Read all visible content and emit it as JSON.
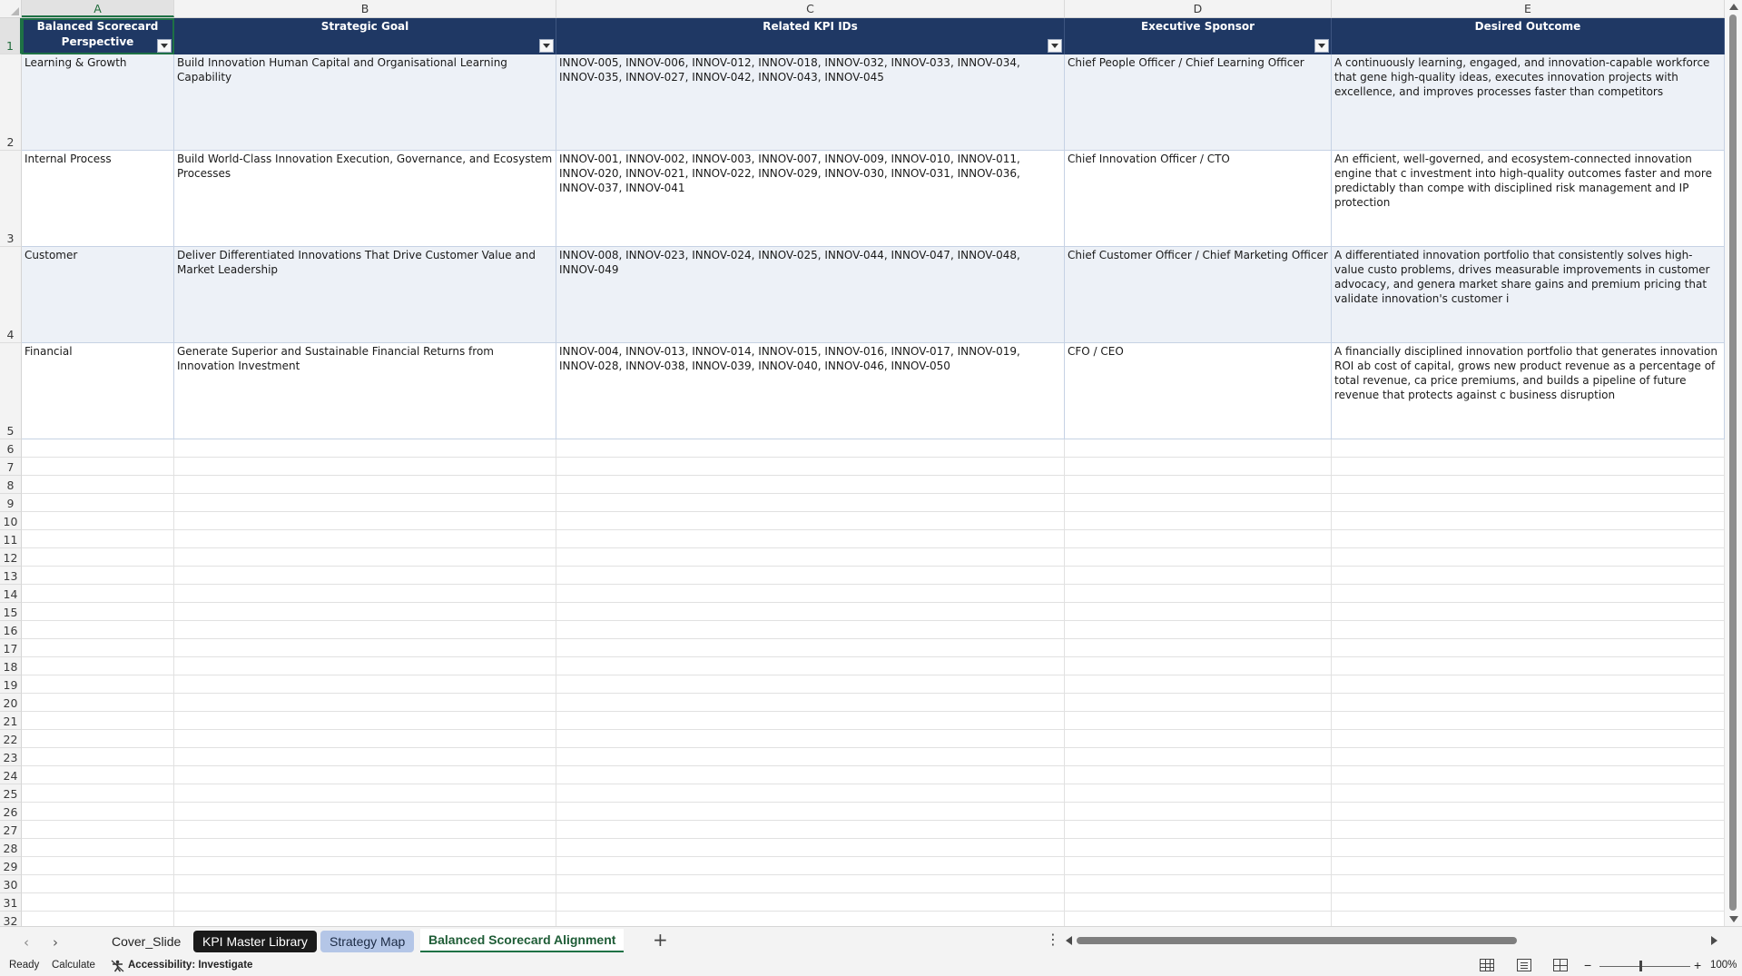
{
  "columns": [
    {
      "letter": "A",
      "header": "Balanced Scorecard Perspective"
    },
    {
      "letter": "B",
      "header": "Strategic Goal"
    },
    {
      "letter": "C",
      "header": "Related KPI IDs"
    },
    {
      "letter": "D",
      "header": "Executive Sponsor"
    },
    {
      "letter": "E",
      "header": "Desired Outcome"
    }
  ],
  "header_row_number": "1",
  "rows": [
    {
      "num": "2",
      "perspective": "Learning & Growth",
      "goal": "Build Innovation Human Capital and Organisational Learning Capability",
      "kpis": "INNOV-005, INNOV-006, INNOV-012, INNOV-018, INNOV-032, INNOV-033, INNOV-034, INNOV-035, INNOV-027, INNOV-042, INNOV-043, INNOV-045",
      "sponsor": "Chief People Officer / Chief Learning Officer",
      "outcome": "A continuously learning, engaged, and innovation-capable workforce that gene high-quality ideas, executes innovation projects with excellence, and improves processes faster than competitors"
    },
    {
      "num": "3",
      "perspective": "Internal Process",
      "goal": "Build World-Class Innovation Execution, Governance, and Ecosystem Processes",
      "kpis": "INNOV-001, INNOV-002, INNOV-003, INNOV-007, INNOV-009, INNOV-010, INNOV-011, INNOV-020, INNOV-021, INNOV-022, INNOV-029, INNOV-030, INNOV-031, INNOV-036, INNOV-037, INNOV-041",
      "sponsor": "Chief Innovation Officer / CTO",
      "outcome": "An efficient, well-governed, and ecosystem-connected innovation engine that c investment into high-quality outcomes faster and more predictably than compe with disciplined risk management and IP protection"
    },
    {
      "num": "4",
      "perspective": "Customer",
      "goal": "Deliver Differentiated Innovations That Drive Customer Value and Market Leadership",
      "kpis": "INNOV-008, INNOV-023, INNOV-024, INNOV-025, INNOV-044, INNOV-047, INNOV-048, INNOV-049",
      "sponsor": "Chief Customer Officer / Chief Marketing Officer",
      "outcome": "A differentiated innovation portfolio that consistently solves high-value custo problems, drives measurable improvements in customer advocacy, and genera market share gains and premium pricing that validate innovation's customer i"
    },
    {
      "num": "5",
      "perspective": "Financial",
      "goal": "Generate Superior and Sustainable Financial Returns from Innovation Investment",
      "kpis": "INNOV-004, INNOV-013, INNOV-014, INNOV-015, INNOV-016, INNOV-017, INNOV-019, INNOV-028, INNOV-038, INNOV-039, INNOV-040, INNOV-046, INNOV-050",
      "sponsor": "CFO / CEO",
      "outcome": "A financially disciplined innovation portfolio that generates innovation ROI ab cost of capital, grows new product revenue as a percentage of total revenue, ca price premiums, and builds a pipeline of future revenue that protects against c business disruption"
    }
  ],
  "empty_rows": [
    "6",
    "7",
    "8",
    "9",
    "10",
    "11",
    "12",
    "13",
    "14",
    "15",
    "16",
    "17",
    "18",
    "19",
    "20",
    "21",
    "22",
    "23",
    "24",
    "25",
    "26",
    "27",
    "28",
    "29",
    "30",
    "31",
    "32"
  ],
  "sheet_tabs": [
    {
      "label": "Cover_Slide",
      "style": "plain"
    },
    {
      "label": "KPI Master Library",
      "style": "dark"
    },
    {
      "label": "Strategy Map",
      "style": "blue"
    },
    {
      "label": "Balanced Scorecard Alignment",
      "style": "active"
    }
  ],
  "status": {
    "ready": "Ready",
    "calculate": "Calculate",
    "accessibility": "Accessibility: Investigate",
    "zoom": "100%",
    "zoom_minus": "−",
    "zoom_plus": "+"
  },
  "icons": {
    "add_sheet": "plus-icon",
    "more": "vertical-ellipsis-icon",
    "accessibility": "accessibility-icon"
  },
  "colors": {
    "header_fill": "#1f3864",
    "band_fill": "#edf1f7",
    "selection_green": "#1e7145",
    "dark_tab": "#1a1a1a",
    "blue_tab": "#b4c6e7"
  }
}
